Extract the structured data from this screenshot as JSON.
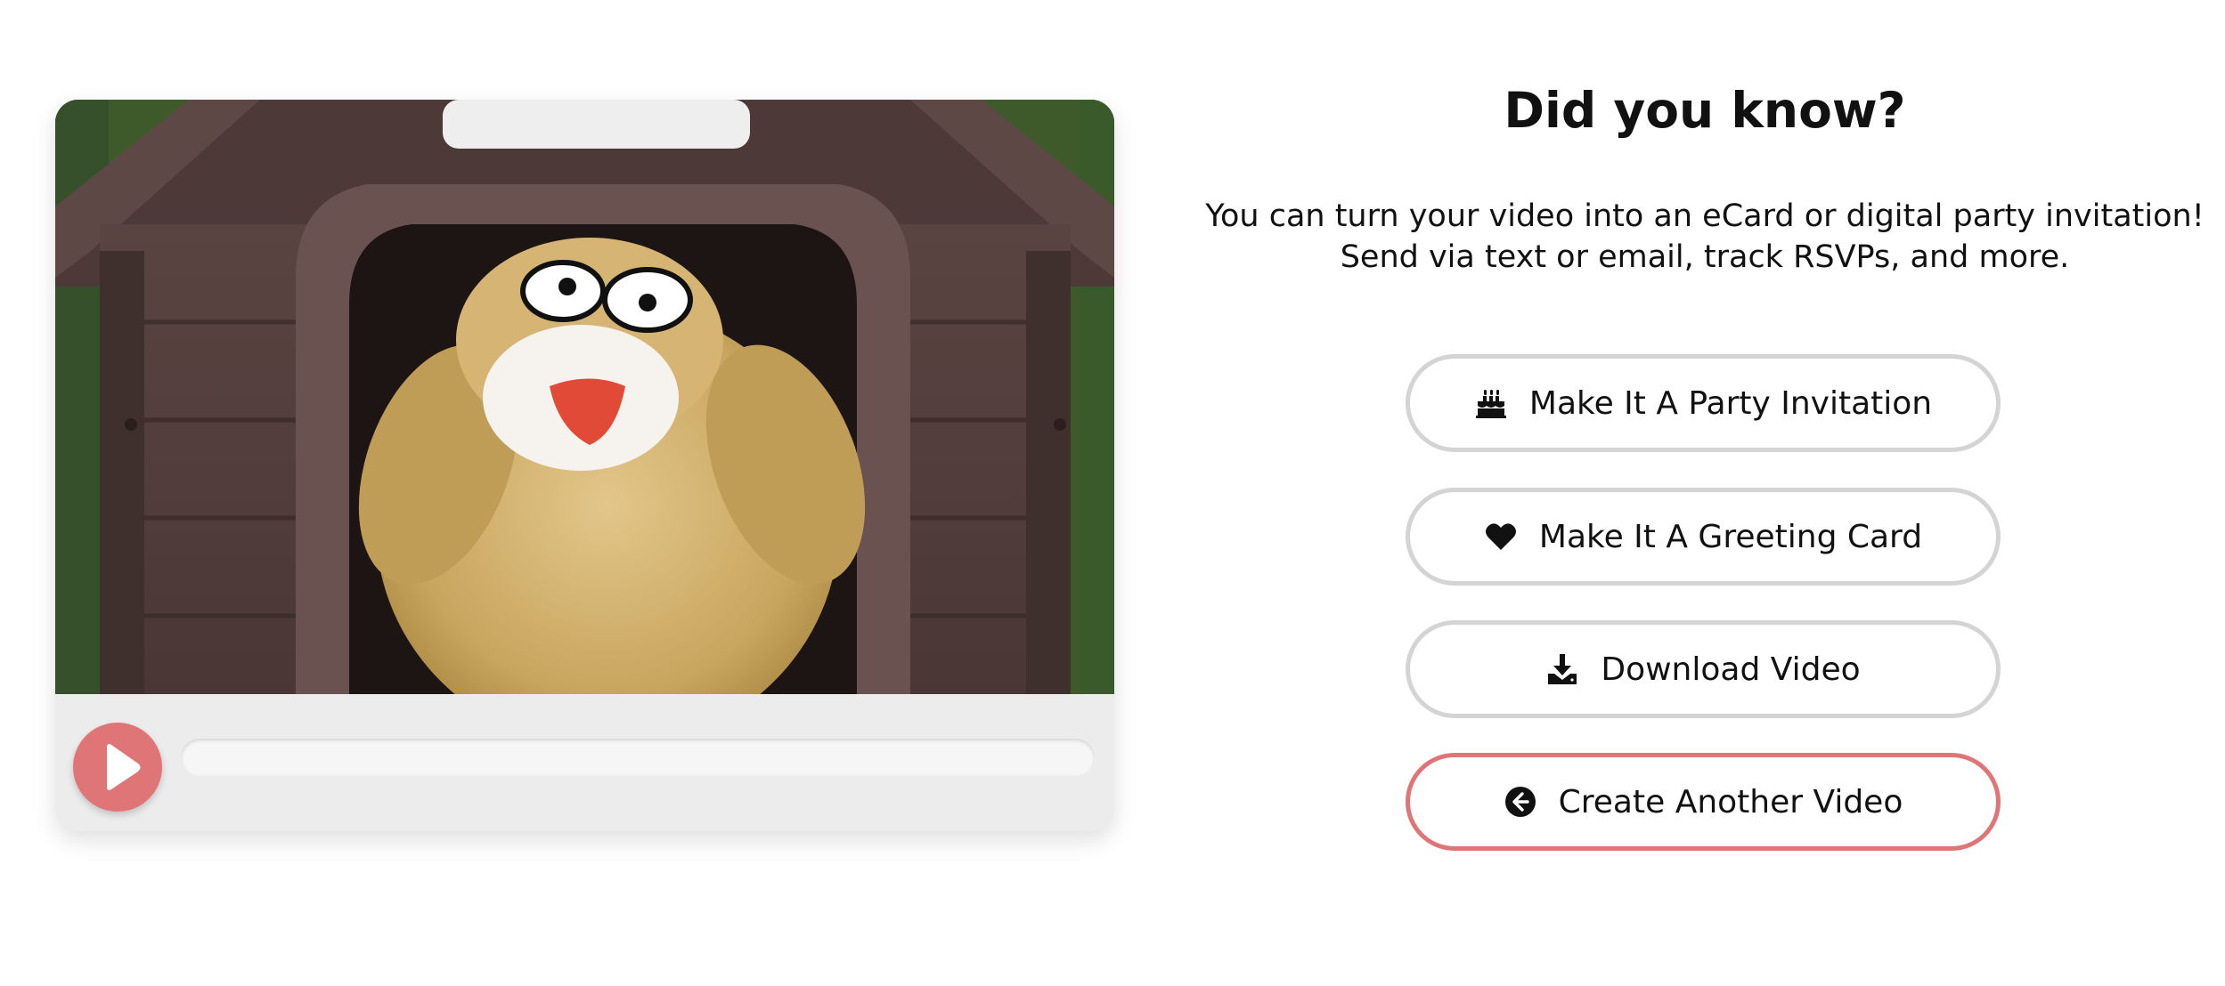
{
  "video_player": {
    "progress": 0,
    "accent_color": "#e07578",
    "play_icon": "play-icon"
  },
  "info": {
    "title": "Did you know?",
    "body_line_1": "You can turn your video into an eCard or digital party invitation!",
    "body_line_2": "Send via text or email, track RSVPs, and more."
  },
  "actions": [
    {
      "label": "Make It A Party Invitation",
      "icon": "birthday-cake-icon"
    },
    {
      "label": "Make It A Greeting Card",
      "icon": "heart-icon"
    },
    {
      "label": "Download Video",
      "icon": "download-icon"
    },
    {
      "label": "Create Another Video",
      "icon": "arrow-left-circle-icon"
    }
  ]
}
